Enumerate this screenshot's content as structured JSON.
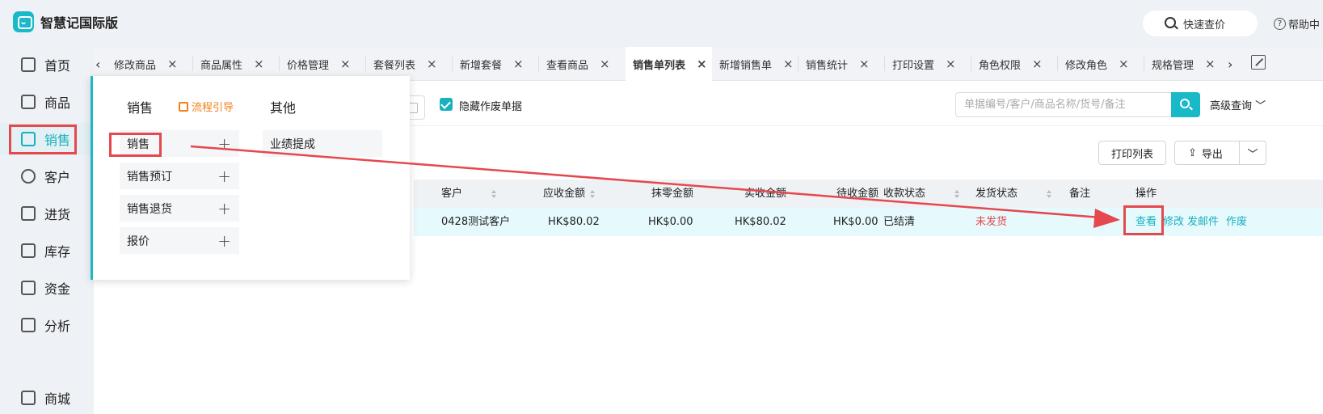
{
  "app": {
    "title": "智慧记国际版"
  },
  "header": {
    "quick_price": "快速查价",
    "help": "帮助中"
  },
  "sidebar": {
    "items": [
      {
        "label": "首页"
      },
      {
        "label": "商品"
      },
      {
        "label": "销售"
      },
      {
        "label": "客户"
      },
      {
        "label": "进货"
      },
      {
        "label": "库存"
      },
      {
        "label": "资金"
      },
      {
        "label": "分析"
      },
      {
        "label": "商城"
      }
    ]
  },
  "tabs": [
    {
      "label": "修改商品"
    },
    {
      "label": "商品属性"
    },
    {
      "label": "价格管理"
    },
    {
      "label": "套餐列表"
    },
    {
      "label": "新增套餐"
    },
    {
      "label": "查看商品"
    },
    {
      "label": "销售单列表"
    },
    {
      "label": "新增销售单"
    },
    {
      "label": "销售统计"
    },
    {
      "label": "打印设置"
    },
    {
      "label": "角色权限"
    },
    {
      "label": "修改角色"
    },
    {
      "label": "规格管理"
    }
  ],
  "filters": {
    "hide_void_label": "隐藏作废单据",
    "search_placeholder": "单据编号/客户/商品名称/货号/备注",
    "advanced": "高级查询"
  },
  "actions": {
    "print_list": "打印列表",
    "export": "导出"
  },
  "table": {
    "headers": [
      "客户",
      "应收金额",
      "抹零金额",
      "实收金额",
      "待收金额",
      "收款状态",
      "发货状态",
      "备注",
      "操作"
    ],
    "rows": [
      {
        "customer": "0428测试客户",
        "receivable": "HK$80.02",
        "rounding": "HK$0.00",
        "received": "HK$80.02",
        "pending": "HK$0.00",
        "payment_status": "已结清",
        "ship_status": "未发货",
        "remark": "",
        "ops": [
          "查看",
          "修改",
          "发邮件",
          "作废"
        ]
      }
    ]
  },
  "popup": {
    "col1_title": "销售",
    "guide": "流程引导",
    "col2_title": "其他",
    "col1_items": [
      {
        "label": "销售"
      },
      {
        "label": "销售预订"
      },
      {
        "label": "销售退货"
      },
      {
        "label": "报价"
      }
    ],
    "col2_items": [
      {
        "label": "业绩提成"
      }
    ]
  },
  "colors": {
    "accent": "#19b9c8",
    "annotation": "#e5484d",
    "guide": "#f0801a",
    "row_highlight": "#e6fafd"
  }
}
